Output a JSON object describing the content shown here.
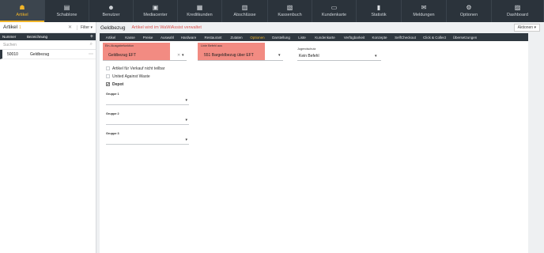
{
  "nav": [
    {
      "label": "Artikel",
      "icon": "☗",
      "active": true
    },
    {
      "label": "Schablone",
      "icon": "▤"
    },
    {
      "label": "Benutzer",
      "icon": "☻"
    },
    {
      "label": "Mediacenter",
      "icon": "▣"
    },
    {
      "label": "Kreditkunden",
      "icon": "▦"
    },
    {
      "label": "Abschlüsse",
      "icon": "▥"
    },
    {
      "label": "Kassenbuch",
      "icon": "▧"
    },
    {
      "label": "Kundenkarte",
      "icon": "▭"
    },
    {
      "label": "Statistik",
      "icon": "▮"
    },
    {
      "label": "Meldungen",
      "icon": "✉"
    },
    {
      "label": "Optionen",
      "icon": "⚙"
    },
    {
      "label": "Dashboard",
      "icon": "▨"
    }
  ],
  "sidebar": {
    "title": "Artikel",
    "count": "1",
    "filter": "Filter",
    "col_number": "Nummer",
    "col_name": "Bezeichnung",
    "search_placeholder": "Suchen",
    "rows": [
      {
        "number": "50010",
        "name": "Geldbezug"
      }
    ]
  },
  "main": {
    "title": "Geldbezug",
    "warning": "Artikel wird im WaWiAssist verwaltet",
    "actions": "Aktionen"
  },
  "tabs": [
    "Artikel",
    "Kasse",
    "Preise",
    "Auswahl",
    "Hardware",
    "Restaurant",
    "Zutaten",
    "Optionen",
    "Darstellung",
    "Liste",
    "Kundenkarte",
    "Verfügbarkeit",
    "Konzepte",
    "SelfCheckout",
    "Click & Collect",
    "Übersetzungen"
  ],
  "active_tab": "Optionen",
  "form": {
    "ein_label": "Ein-/Ausgabefunktion",
    "ein_value": "Geldbezug EFT",
    "linie_label": "Linie Befehl aus",
    "linie_value": "551 Bargeldbezug über EFT",
    "jugend_label": "Jugendschutz",
    "jugend_value": "Kein Befehl",
    "cb1": "Artikel für Verkauf nicht teilbar",
    "cb2": "United Against Waste",
    "cb3": "Depot",
    "g1": "Gruppe 1",
    "g2": "Gruppe 2",
    "g3": "Gruppe 3"
  },
  "colors": {
    "accent": "#f0b429",
    "highlight": "#f28b82",
    "nav_bg": "#2b333b",
    "warning": "#d9534f"
  }
}
